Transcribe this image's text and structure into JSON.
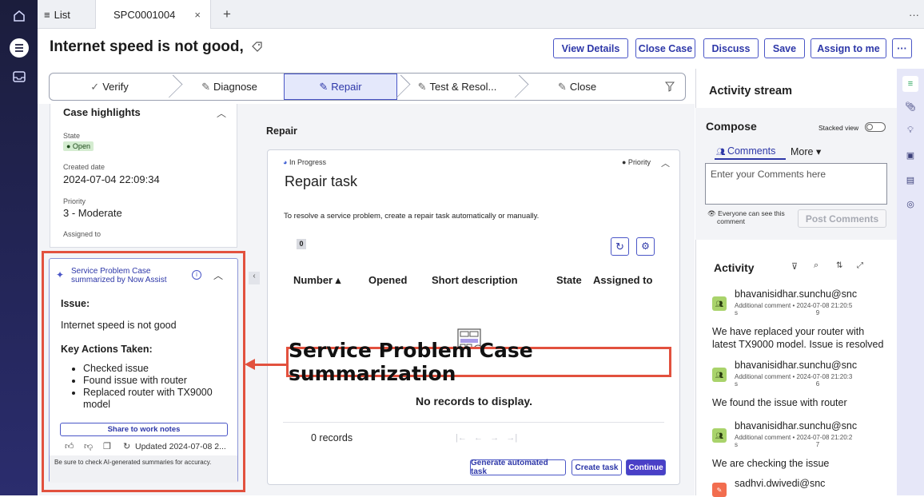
{
  "tabs": {
    "list_label": "List",
    "record_tab": "SPC0001004",
    "close_icon": "×",
    "add_icon": "+",
    "more": "···"
  },
  "header": {
    "title": "Internet speed is not good,",
    "buttons": [
      "View Details",
      "Close Case",
      "Discuss",
      "Save",
      "Assign to me"
    ],
    "overflow": "···"
  },
  "stepper": {
    "steps": [
      {
        "label": "Verify",
        "icon": "✓"
      },
      {
        "label": "Diagnose",
        "icon": "✎"
      },
      {
        "label": "Repair",
        "icon": "✎"
      },
      {
        "label": "Test & Resol...",
        "icon": "✎"
      },
      {
        "label": "Close",
        "icon": "✎"
      }
    ],
    "filter_icon": "filter-icon"
  },
  "highlights": {
    "title": "Case highlights",
    "state_label": "State",
    "state_value": "● Open",
    "created_label": "Created date",
    "created_value": "2024-07-04 22:09:34",
    "priority_label": "Priority",
    "priority_value": "3 - Moderate",
    "assigned_label": "Assigned to"
  },
  "summary": {
    "heading_line1": "Service Problem Case",
    "heading_line2": "summarized by Now Assist",
    "issue_title": "Issue:",
    "issue_text": "Internet speed is not good",
    "actions_title": "Key Actions Taken:",
    "actions": [
      "Checked issue",
      "Found issue with router",
      "Replaced router with TX9000 model"
    ],
    "share_button": "Share to work notes",
    "updated": "Updated 2024-07-08 2...",
    "disclaimer": "Be sure to check AI-generated summaries for accuracy."
  },
  "main": {
    "section_title": "Repair",
    "status": "In Progress",
    "priority_tag": "● Priority",
    "task_title": "Repair task",
    "description": "To resolve a service problem, create a repair task automatically or manually.",
    "count_badge": "0",
    "columns": [
      "Number ▴",
      "Opened",
      "Short description",
      "State",
      "Assigned to"
    ],
    "empty_text": "No records to display.",
    "records": "0 records",
    "pager": "|←   ←   →   →|",
    "buttons": [
      "Generate automated task",
      "Create task",
      "Continue"
    ]
  },
  "activity": {
    "stream_title": "Activity stream",
    "compose_title": "Compose",
    "stacked_view": "Stacked view",
    "comments_tab": "Comments",
    "more_tab": "More ▾",
    "placeholder": "Enter your Comments here",
    "visibility_line1": "Everyone can see this",
    "visibility_line2": "comment",
    "post_button": "Post Comments",
    "activity_title": "Activity",
    "entries": [
      {
        "author": "bhavanisidhar.sunchu@snc",
        "meta": "Additional comment  •  2024-07-08 21:20:5",
        "meta2": "s                                            9",
        "text": "We have replaced your router with latest TX9000 model. Issue is resolved"
      },
      {
        "author": "bhavanisidhar.sunchu@snc",
        "meta": "Additional comment  •  2024-07-08 21:20:3",
        "meta2": "s                                            6",
        "text": "We found the issue with router"
      },
      {
        "author": "bhavanisidhar.sunchu@snc",
        "meta": "Additional comment  •  2024-07-08 21:20:2",
        "meta2": "s                                            7",
        "text": "We are checking the issue"
      },
      {
        "author": "sadhvi.dwivedi@snc",
        "meta": "",
        "meta2": "",
        "text": ""
      }
    ]
  },
  "annotation": {
    "callout_text": "Service Problem Case summarization"
  },
  "colors": {
    "accent": "#2d37a8",
    "annotation": "#e2513e",
    "open_badge": "#d4ecd0",
    "nav_bg": "#1b1d3c"
  }
}
